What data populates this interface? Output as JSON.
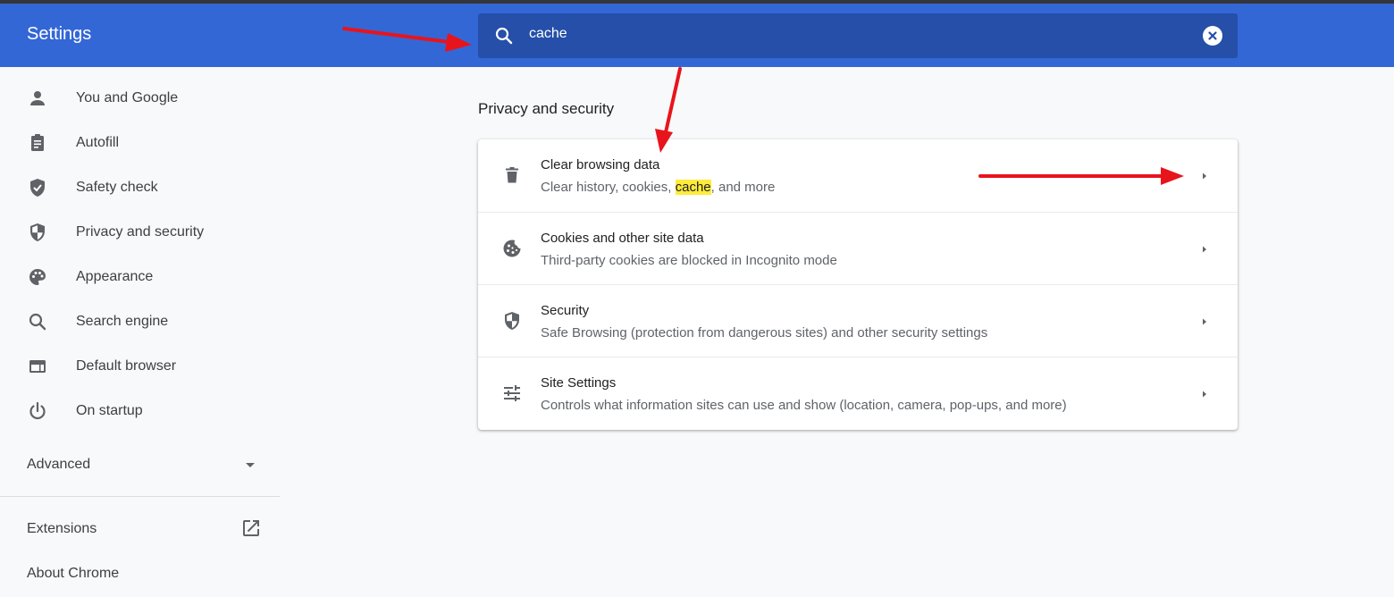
{
  "app": {
    "title": "Settings"
  },
  "search": {
    "query": "cache",
    "icon": "search-icon"
  },
  "sidebar": {
    "items": [
      {
        "label": "You and Google",
        "icon": "person-icon"
      },
      {
        "label": "Autofill",
        "icon": "clipboard-icon"
      },
      {
        "label": "Safety check",
        "icon": "shield-check-icon"
      },
      {
        "label": "Privacy and security",
        "icon": "shield-half-icon"
      },
      {
        "label": "Appearance",
        "icon": "palette-icon"
      },
      {
        "label": "Search engine",
        "icon": "search-icon"
      },
      {
        "label": "Default browser",
        "icon": "browser-icon"
      },
      {
        "label": "On startup",
        "icon": "power-icon"
      }
    ],
    "advanced": "Advanced",
    "extensions": "Extensions",
    "about": "About Chrome"
  },
  "main": {
    "section_title": "Privacy and security",
    "rows": [
      {
        "title": "Clear browsing data",
        "subtitle_before": "Clear history, cookies, ",
        "subtitle_highlight": "cache",
        "subtitle_after": ", and more",
        "icon": "trash-icon"
      },
      {
        "title": "Cookies and other site data",
        "subtitle": "Third-party cookies are blocked in Incognito mode",
        "icon": "cookie-icon"
      },
      {
        "title": "Security",
        "subtitle": "Safe Browsing (protection from dangerous sites) and other security settings",
        "icon": "shield-half-icon"
      },
      {
        "title": "Site Settings",
        "subtitle": "Controls what information sites can use and show (location, camera, pop-ups, and more)",
        "icon": "tune-icon"
      }
    ]
  },
  "colors": {
    "header": "#3367d6",
    "search_bg": "#254fa8",
    "highlight": "#ffeb3b",
    "annotation_arrow": "#e8141c"
  }
}
